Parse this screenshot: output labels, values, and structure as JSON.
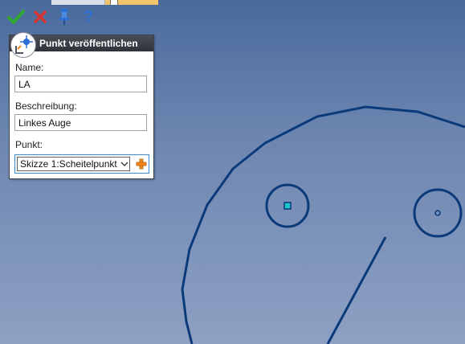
{
  "toolbar": {
    "ok_icon": "check-icon",
    "cancel_icon": "cancel-icon",
    "pin_icon": "pin-icon",
    "help_icon": "help-icon"
  },
  "panel": {
    "title": "Punkt veröffentlichen",
    "icon": "publish-point-icon",
    "name_label": "Name:",
    "name_value": "LA",
    "description_label": "Beschreibung:",
    "description_value": "Linkes Auge",
    "point_label": "Punkt:",
    "point_selected": "Skizze 1:Scheitelpunkt",
    "add_icon": "add-icon"
  },
  "colors": {
    "sketch_line": "#0b3a7a",
    "selected_point": "#1fc7c7",
    "ok_green": "#2faa2f",
    "cancel_red": "#d8332f",
    "help_blue": "#2a6fd6",
    "accent_orange": "#f08a1c"
  }
}
